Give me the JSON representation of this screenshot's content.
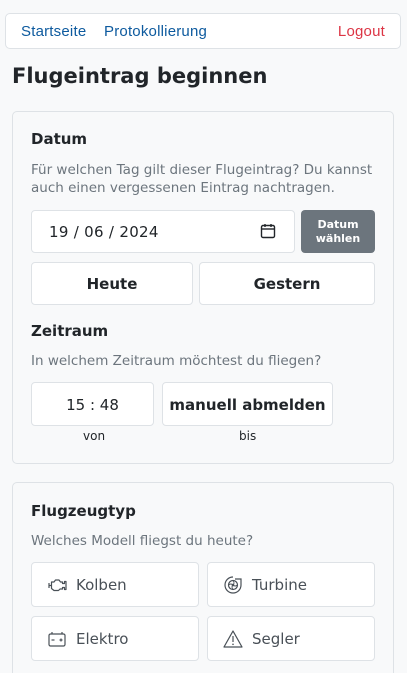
{
  "nav": {
    "home": "Startseite",
    "log": "Protokollierung",
    "logout": "Logout"
  },
  "page": {
    "title": "Flugeintrag beginnen"
  },
  "datum": {
    "heading": "Datum",
    "help_line1": "Für welchen Tag gilt dieser Flugeintrag? Du kannst",
    "help_line2": "auch einen vergessenen Eintrag nachtragen.",
    "value": "19 / 06 / 2024",
    "picker_line1": "Datum",
    "picker_line2": "wählen",
    "today": "Heute",
    "yesterday": "Gestern"
  },
  "zeitraum": {
    "heading": "Zeitraum",
    "help": "In welchem Zeitraum möchtest du fliegen?",
    "from_value": "15 : 48",
    "to_value": "manuell abmelden",
    "from_label": "von",
    "to_label": "bis"
  },
  "flugzeugtyp": {
    "heading": "Flugzeugtyp",
    "help": "Welches Modell fliegst du heute?",
    "options": [
      {
        "label": "Kolben",
        "icon": "engine-icon"
      },
      {
        "label": "Turbine",
        "icon": "turbine-icon"
      },
      {
        "label": "Elektro",
        "icon": "battery-icon"
      },
      {
        "label": "Segler",
        "icon": "glider-icon"
      }
    ]
  }
}
